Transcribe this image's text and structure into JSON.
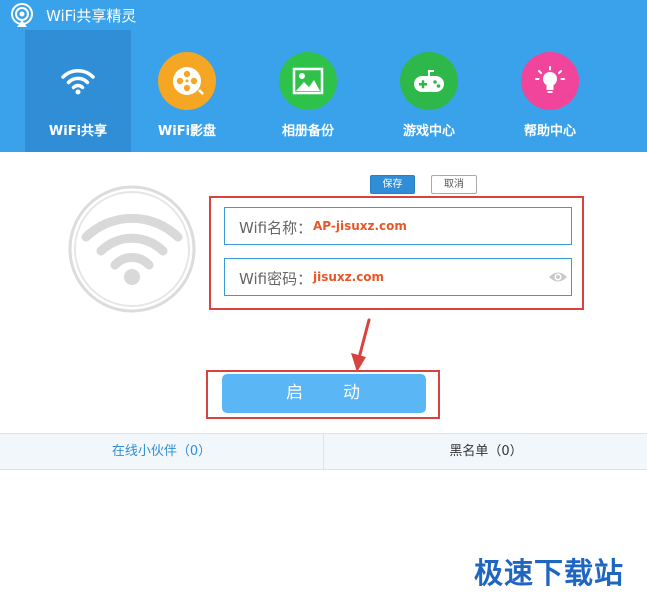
{
  "app": {
    "title": "WiFi共享精灵"
  },
  "nav": [
    {
      "label": "WiFi共享",
      "icon": "wifi-icon",
      "color": "#2f8ed6"
    },
    {
      "label": "WiFi影盘",
      "icon": "film-reel-icon",
      "color": "#f5a623"
    },
    {
      "label": "相册备份",
      "icon": "image-icon",
      "color": "#2fc24a"
    },
    {
      "label": "游戏中心",
      "icon": "gamepad-icon",
      "color": "#2fb84a"
    },
    {
      "label": "帮助中心",
      "icon": "lightbulb-icon",
      "color": "#f0459a"
    }
  ],
  "actions": {
    "save_label": "保存",
    "cancel_label": "取消"
  },
  "form": {
    "name_label": "Wifi名称：",
    "name_value": "AP-jisuxz.com",
    "password_label": "Wifi密码：",
    "password_value": "jisuxz.com"
  },
  "start_button": {
    "label": "启　　动"
  },
  "tabs": {
    "online_label": "在线小伙伴（0）",
    "blacklist_label": "黑名单（0）"
  },
  "watermark": {
    "text": "极速下载站"
  },
  "colors": {
    "header": "#3aa2ea",
    "accent": "#2f8ed6",
    "highlight_red": "#d9433f",
    "value_orange": "#e8572a"
  }
}
